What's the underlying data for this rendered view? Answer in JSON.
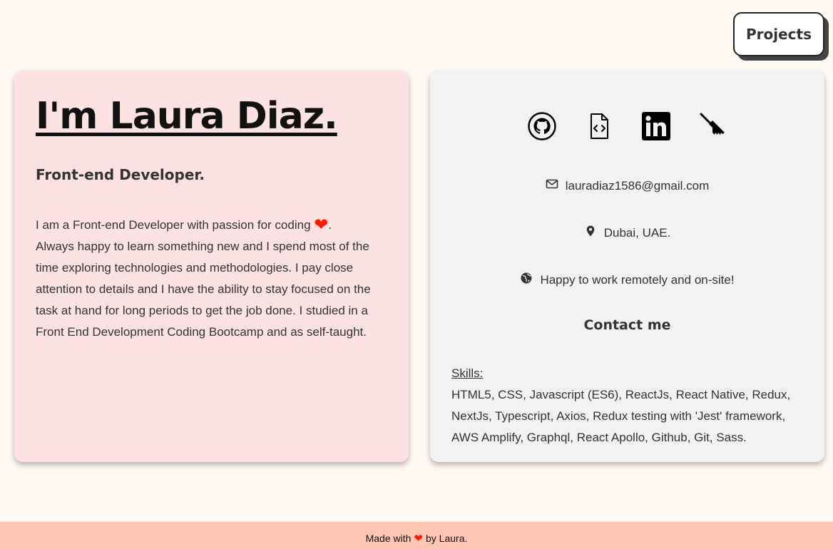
{
  "nav": {
    "projects_label": "Projects"
  },
  "intro": {
    "name": "I'm Laura Diaz.",
    "role": "Front-end Developer.",
    "bio_first": "I am a Front-end Developer with passion for coding",
    "bio_first_end": ".",
    "bio_rest": "Always happy to learn something new and I spend most of the time exploring technologies and methodologies. I pay close attention to details and I have the ability to stay focused on the task at hand for long periods to get the job done. I studied in a Front End Development Coding Bootcamp and as self-taught."
  },
  "icons": {
    "heart": "heart-icon",
    "social": [
      "github-icon",
      "code-file-icon",
      "linkedin-icon",
      "broom-icon"
    ],
    "email": "envelope-icon",
    "location": "location-pin-icon",
    "remote": "globe-icon"
  },
  "contact": {
    "email": "lauradiaz1586@gmail.com",
    "location": "Dubai, UAE.",
    "availability": "Happy to work remotely and on-site!",
    "title": "Contact me"
  },
  "skills": {
    "label": "Skills:",
    "list": "HTML5, CSS, Javascript (ES6), ReactJs, React Native, Redux, NextJs, Typescript, Axios, Redux testing with 'Jest' framework, AWS Amplify, Graphql, React Apollo, Github, Git, Sass."
  },
  "footer": {
    "prefix": "Made with",
    "suffix": "by Laura."
  },
  "colors": {
    "page_bg": "#fff8f3",
    "left_card_bg": "#fde2e4",
    "right_card_bg": "#f2f2f2",
    "footer_bg": "#ffc6b4",
    "heart": "#ff1a00"
  }
}
